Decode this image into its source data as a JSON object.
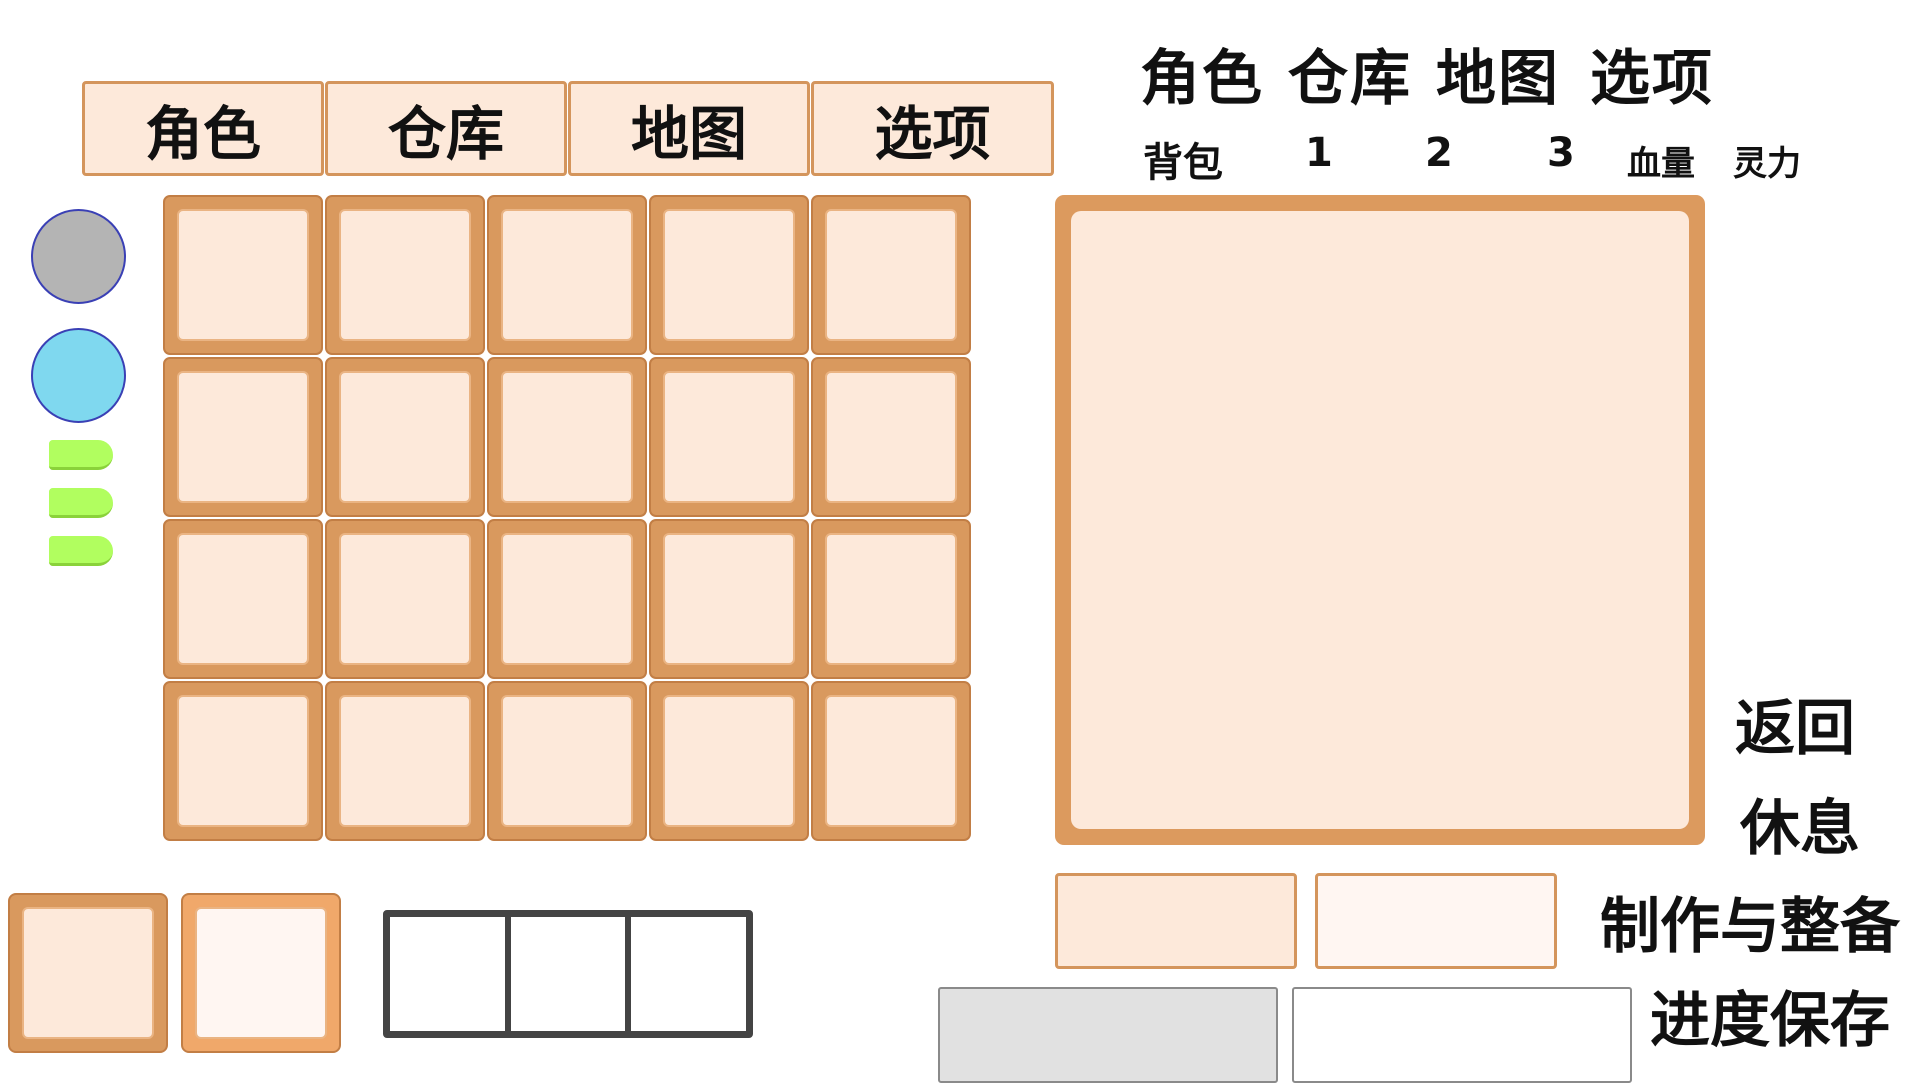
{
  "top_tabs": [
    "角色",
    "仓库",
    "地图",
    "选项"
  ],
  "header": {
    "tabs": [
      "角色",
      "仓库",
      "地图",
      "选项"
    ],
    "sub_items": [
      "背包",
      "1",
      "2",
      "3",
      "血量",
      "灵力"
    ]
  },
  "status": {
    "circles": [
      {
        "name": "gray-orb",
        "color": "#b4b4b4"
      },
      {
        "name": "blue-orb",
        "color": "#7fd8ef"
      }
    ],
    "pill_color": "#b1fe5f",
    "pill_count": 3
  },
  "inventory": {
    "rows": 4,
    "cols": 5
  },
  "side_actions": {
    "back": "返回",
    "rest": "休息",
    "craft": "制作与整备",
    "save": "进度保存"
  },
  "colors": {
    "slot_border": "#d9995e",
    "slot_fill": "#fde9da",
    "save_box_1": "#e1e1e1",
    "save_box_2": "#ffffff",
    "craft_box_1": "#fde9da",
    "craft_box_2": "#fff6f2"
  }
}
